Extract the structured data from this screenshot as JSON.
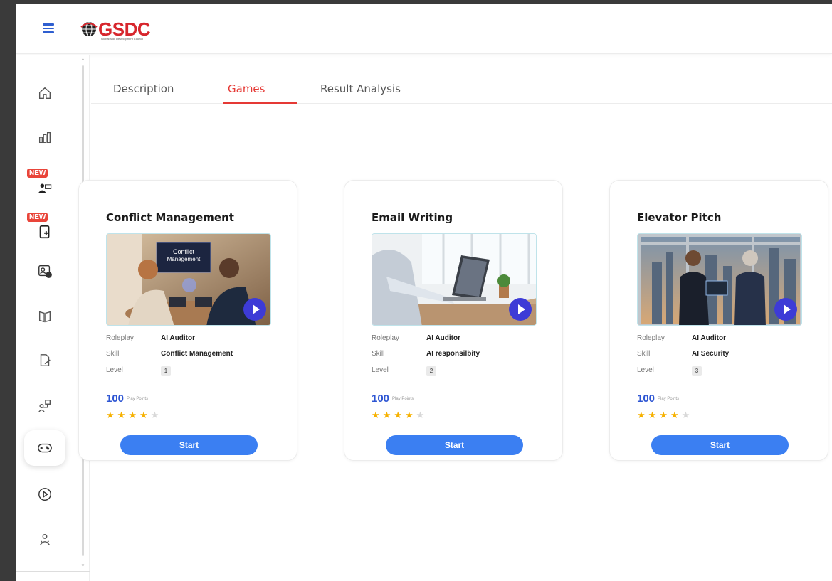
{
  "header": {
    "logo_text": "GSDC",
    "logo_tagline": "Global Skill Development Council"
  },
  "tabs": [
    {
      "label": "Description",
      "active": false
    },
    {
      "label": "Games",
      "active": true
    },
    {
      "label": "Result Analysis",
      "active": false
    }
  ],
  "sidebar": {
    "items": [
      {
        "icon": "home-icon"
      },
      {
        "icon": "bar-chart-icon"
      },
      {
        "icon": "users-board-icon",
        "badge": "NEW"
      },
      {
        "icon": "tablet-add-icon",
        "badge": "NEW"
      },
      {
        "icon": "contact-card-icon"
      },
      {
        "icon": "book-icon"
      },
      {
        "icon": "document-edit-icon"
      },
      {
        "icon": "workflow-icon"
      },
      {
        "icon": "gamepad-icon",
        "active": true
      },
      {
        "icon": "play-circle-icon"
      },
      {
        "icon": "user-group-icon"
      }
    ]
  },
  "cards": [
    {
      "title": "Conflict Management",
      "image_text": "Conflict Management",
      "roleplay_label": "Roleplay",
      "roleplay": "AI Auditor",
      "skill_label": "Skill",
      "skill": "Conflict Management",
      "level_label": "Level",
      "level": "1",
      "points": "100",
      "points_label": "Play Points",
      "rating": 4,
      "rating_max": 5,
      "start_label": "Start"
    },
    {
      "title": "Email Writing",
      "roleplay_label": "Roleplay",
      "roleplay": "AI Auditor",
      "skill_label": "Skill",
      "skill": "AI responsilbity",
      "level_label": "Level",
      "level": "2",
      "points": "100",
      "points_label": "Play Points",
      "rating": 4,
      "rating_max": 5,
      "start_label": "Start"
    },
    {
      "title": "Elevator Pitch",
      "roleplay_label": "Roleplay",
      "roleplay": "AI Auditor",
      "skill_label": "Skill",
      "skill": "AI Security",
      "level_label": "Level",
      "level": "3",
      "points": "100",
      "points_label": "Play Points",
      "rating": 4,
      "rating_max": 5,
      "start_label": "Start"
    }
  ],
  "colors": {
    "accent_red": "#e53935",
    "points_blue": "#2e56d3",
    "button_blue": "#3b7ff2",
    "play_purple": "#3d3bd6",
    "star_gold": "#f6b100"
  }
}
